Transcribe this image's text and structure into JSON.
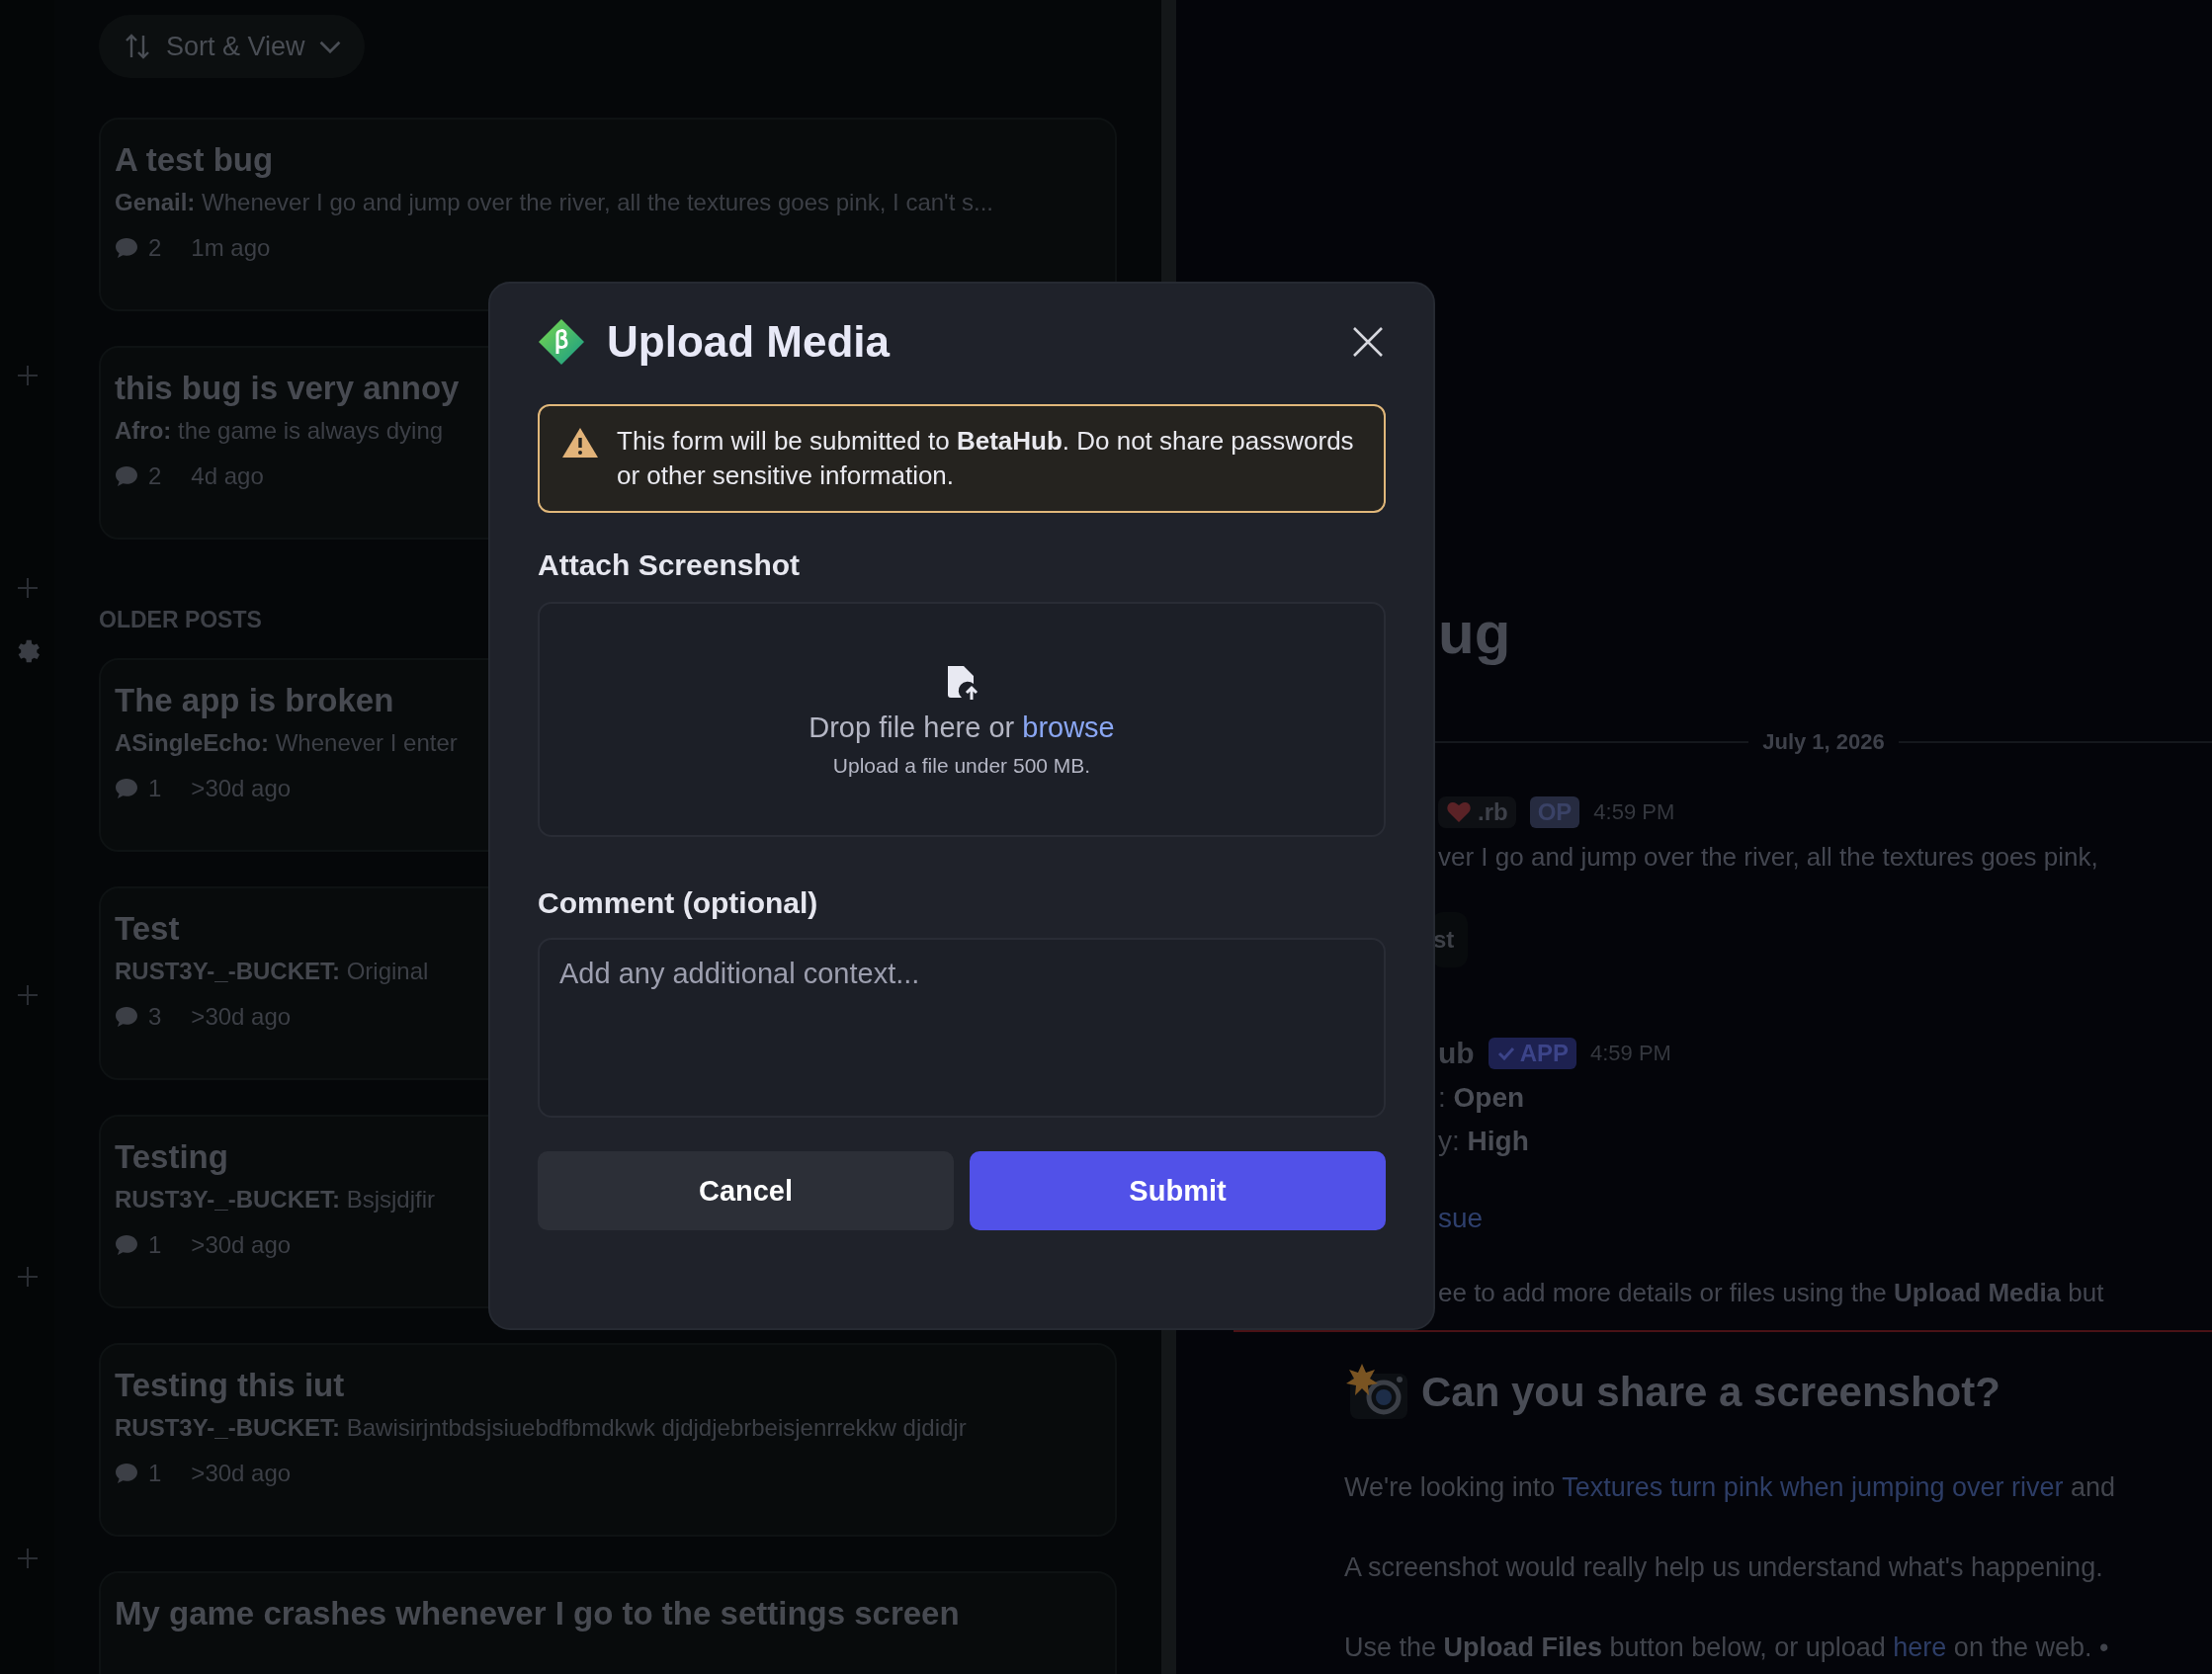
{
  "sort_button": {
    "label": "Sort & View"
  },
  "sections": [
    {
      "posts": [
        {
          "title": "A test bug",
          "excerpt": "**Genail:** Whenever I go and jump over the river, all the textures goes pink, I can't s...",
          "comments": "2",
          "age": "1m ago"
        },
        {
          "title": "this bug is very annoy",
          "excerpt": "**Afro:** the game is always dying",
          "comments": "2",
          "age": "4d ago"
        }
      ]
    },
    {
      "header": "OLDER POSTS",
      "posts": [
        {
          "title": "The app is broken",
          "excerpt": "**ASingleEcho:** Whenever I enter",
          "comments": "1",
          "age": ">30d ago"
        },
        {
          "title": "Test",
          "excerpt": "**RUST3Y-_-BUCKET:** Original",
          "comments": "3",
          "age": ">30d ago"
        },
        {
          "title": "Testing",
          "excerpt": "**RUST3Y-_-BUCKET:** Bsjsjdjfir",
          "comments": "1",
          "age": ">30d ago"
        },
        {
          "title": "Testing this iut",
          "excerpt": "**RUST3Y-_-BUCKET:** Bawisirjntbdsjsiuebdfbmdkwk djdjdjebrbeisjenrrekkw djdidjr",
          "comments": "1",
          "age": ">30d ago"
        },
        {
          "title": "My game crashes whenever I go to the settings screen"
        }
      ]
    }
  ],
  "thread": {
    "title": "ug",
    "date": "July 1, 2026",
    "op_message": {
      "author": ".rb",
      "badge": "OP",
      "time": "4:59 PM",
      "text": "ver I go and jump over the river, all the textures goes pink,"
    },
    "tag": "st",
    "app_message": {
      "author": "ub",
      "badge": "APP",
      "time": "4:59 PM",
      "lines": [
        ": **Open**",
        "y: **High**"
      ],
      "link": "sue",
      "text": "ee to add more details or files using the **Upload Media** but"
    },
    "embed": {
      "title": "Can you share a screenshot?",
      "paragraphs": [
        [
          {
            "text": "We're looking into "
          },
          {
            "text": "Textures turn pink when jumping over river",
            "link": true
          },
          {
            "text": " and"
          }
        ],
        [
          {
            "text": "A screenshot would really help us understand what's happening."
          }
        ],
        [
          {
            "text": "Use the **Upload Files** button below, or upload "
          },
          {
            "text": "here",
            "link": true
          },
          {
            "text": " on the web. •"
          }
        ]
      ]
    }
  },
  "modal": {
    "title": "Upload Media",
    "warning": "This form will be submitted to **BetaHub**. Do not share passwords or other sensitive information.",
    "attach_label": "Attach Screenshot",
    "drop_zone": {
      "prompt": "Drop file here or",
      "link": "browse",
      "hint": "Upload a file under 500 MB."
    },
    "comment_label": "Comment (optional)",
    "comment_field": {
      "placeholder": "Add any additional context..."
    },
    "buttons": [
      {
        "label": "Cancel",
        "kind": "secondary"
      },
      {
        "label": "Submit",
        "kind": "primary"
      }
    ]
  }
}
